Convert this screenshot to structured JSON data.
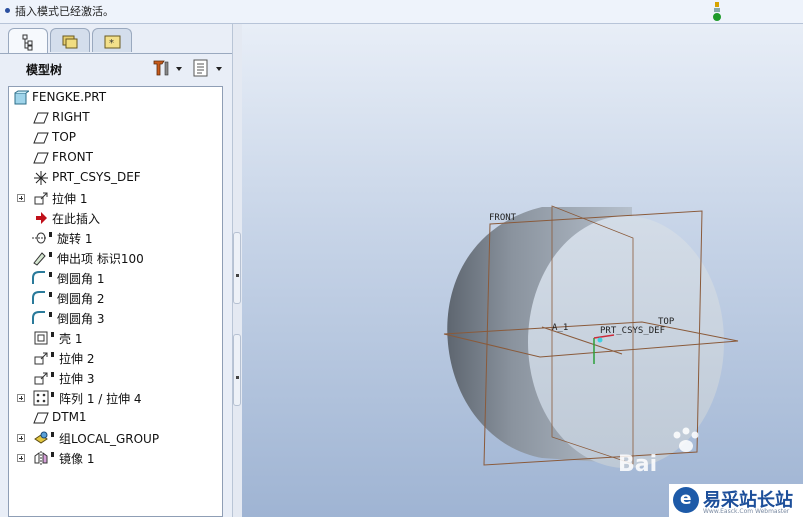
{
  "message_bar": {
    "text": "插入模式已经激活。"
  },
  "tabs": [
    {
      "icon": "model-tree-icon"
    },
    {
      "icon": "folder-browser-icon"
    },
    {
      "icon": "favorites-icon"
    }
  ],
  "tree_header": {
    "title": "模型树",
    "tools": [
      "settings-tools-icon",
      "tree-filter-icon"
    ]
  },
  "tree": {
    "items": [
      {
        "label": "FENGKE.PRT",
        "icon": "part-icon"
      },
      {
        "label": "RIGHT",
        "icon": "datum-plane-icon"
      },
      {
        "label": "TOP",
        "icon": "datum-plane-icon"
      },
      {
        "label": "FRONT",
        "icon": "datum-plane-icon"
      },
      {
        "label": "PRT_CSYS_DEF",
        "icon": "csys-icon"
      },
      {
        "label": "拉伸 1",
        "icon": "extrude-icon"
      },
      {
        "label": "在此插入",
        "icon": "insert-here-arrow-icon"
      },
      {
        "label": "旋转 1",
        "icon": "revolve-icon"
      },
      {
        "label": "伸出项 标识100",
        "icon": "protrusion-icon"
      },
      {
        "label": "倒圆角 1",
        "icon": "round-icon"
      },
      {
        "label": "倒圆角 2",
        "icon": "round-icon"
      },
      {
        "label": "倒圆角 3",
        "icon": "round-icon"
      },
      {
        "label": "壳 1",
        "icon": "shell-icon"
      },
      {
        "label": "拉伸 2",
        "icon": "extrude-icon"
      },
      {
        "label": "拉伸 3",
        "icon": "extrude-icon"
      },
      {
        "label": "阵列 1 / 拉伸 4",
        "icon": "pattern-icon"
      },
      {
        "label": "DTM1",
        "icon": "datum-plane-icon"
      },
      {
        "label": "组LOCAL_GROUP",
        "icon": "group-icon"
      },
      {
        "label": "镜像 1",
        "icon": "mirror-icon"
      }
    ]
  },
  "viewport": {
    "labels": {
      "front": "FRONT",
      "top": "TOP",
      "axis": "A_1",
      "csys": "PRT_CSYS_DEF"
    },
    "watermark": {
      "text": "易采站长站",
      "sub": "Www.Easck.Com Webmaster",
      "baidu": "Bai"
    },
    "colors": {
      "datum": "#8a5a3a",
      "body": "#c9d3df",
      "background": "#a9bcd8"
    }
  }
}
